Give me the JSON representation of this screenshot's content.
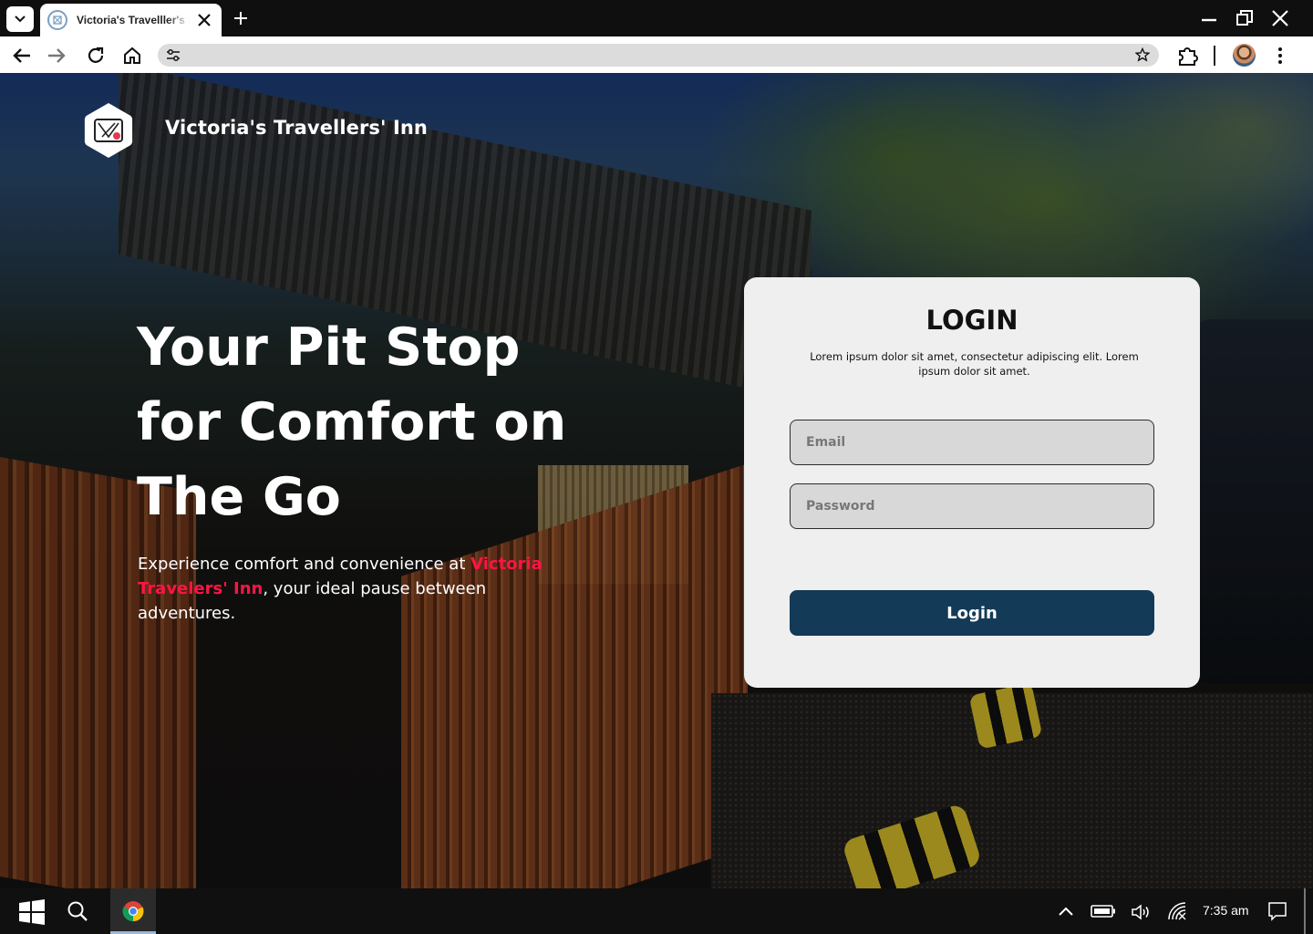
{
  "browser": {
    "tab_title": "Victoria's Travelller's Inn",
    "address": ""
  },
  "site": {
    "brand_name": "Victoria's Travellers' Inn"
  },
  "hero": {
    "title_line1": "Your Pit Stop",
    "title_line2": "for Comfort on",
    "title_line3": "The Go",
    "subtitle_before": "Experience comfort and convenience at ",
    "subtitle_accent": "Victoria Travelers' Inn",
    "subtitle_after": ", your ideal pause between adventures.",
    "accent_color": "#ff1444"
  },
  "login": {
    "title": "LOGIN",
    "description": "Lorem ipsum dolor sit amet, consectetur adipiscing elit. Lorem ipsum dolor sit amet.",
    "email_placeholder": "Email",
    "password_placeholder": "Password",
    "button_label": "Login",
    "button_color": "#133a57"
  },
  "taskbar": {
    "time": "7:35 am"
  },
  "icons": [
    "tab-list-icon",
    "site-favicon-icon",
    "close-tab-icon",
    "new-tab-icon",
    "minimize-icon",
    "restore-icon",
    "close-window-icon",
    "back-icon",
    "forward-icon",
    "reload-icon",
    "home-icon",
    "tune-icon",
    "bookmark-star-icon",
    "extensions-icon",
    "profile-avatar",
    "menu-kebab-icon",
    "windows-start-icon",
    "search-icon",
    "chrome-icon",
    "chevron-up-icon",
    "battery-icon",
    "volume-icon",
    "network-icon",
    "notification-icon"
  ]
}
